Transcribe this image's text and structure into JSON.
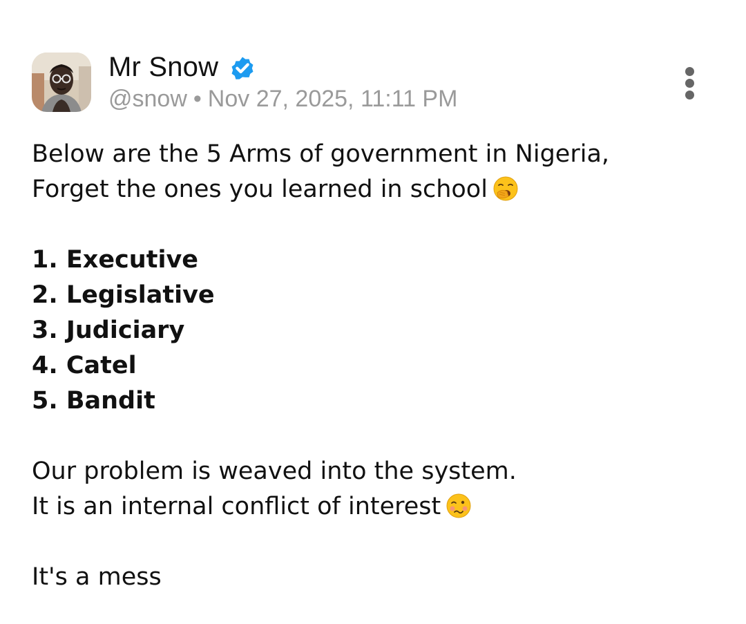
{
  "post": {
    "author": {
      "display_name": "Mr Snow",
      "handle": "@snow",
      "verified": true,
      "avatar_icon": "person-avatar"
    },
    "separator": "•",
    "timestamp": "Nov 27, 2025, 11:11 PM",
    "more_icon": "vertical-ellipsis-icon",
    "body": {
      "intro_line_1": "Below are the 5 Arms of government in Nigeria,",
      "intro_line_2": "Forget the ones you learned in school",
      "intro_emoji": "yawning-face-emoji",
      "arms": [
        "1. Executive",
        "2. Legislative",
        "3. Judiciary",
        "4. Catel",
        "5. Bandit"
      ],
      "closing_line_1": "Our problem is weaved into the system.",
      "closing_line_2": "It is an internal conflict of interest",
      "closing_emoji": "woozy-face-emoji",
      "final_line": "It's a mess"
    }
  },
  "colors": {
    "verified_badge": "#1d9bf0",
    "meta_text": "#9a9a9a",
    "body_text": "#111111"
  }
}
